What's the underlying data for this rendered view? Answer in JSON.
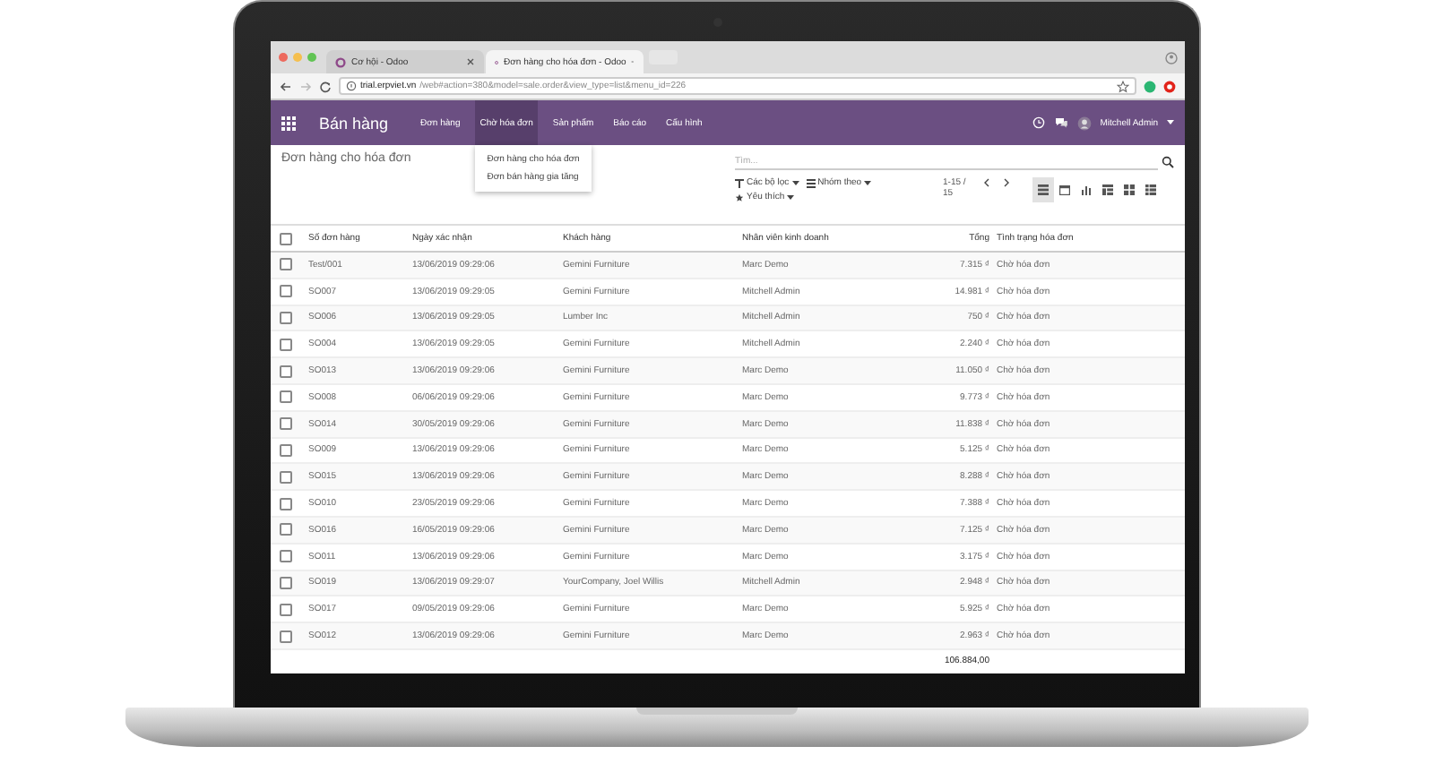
{
  "browser": {
    "tabs": [
      {
        "title": "Cơ hội - Odoo",
        "selected": false
      },
      {
        "title": "Đơn hàng cho hóa đơn - Odoo",
        "selected": true
      }
    ],
    "url_host": "trial.erpviet.vn",
    "url_path": "/web#action=380&model=sale.order&view_type=list&menu_id=226"
  },
  "navbar": {
    "app_name": "Bán hàng",
    "menu": [
      {
        "label": "Đơn hàng",
        "selected": false
      },
      {
        "label": "Chờ hóa đơn",
        "selected": true,
        "dropdown": [
          "Đơn hàng cho hóa đơn",
          "Đơn bán hàng gia tăng"
        ]
      },
      {
        "label": "Sản phẩm",
        "selected": false
      },
      {
        "label": "Báo cáo",
        "selected": false
      },
      {
        "label": "Cấu hình",
        "selected": false
      }
    ],
    "user": "Mitchell Admin"
  },
  "control_panel": {
    "breadcrumb": "Đơn hàng cho hóa đơn",
    "search": {
      "placeholder": "Tìm..."
    },
    "filters": "Các bộ lọc",
    "group_by": "Nhóm theo",
    "favorites": "Yêu thích",
    "pager": "1-15 / 15",
    "view_switcher": [
      {
        "kind": "list",
        "selected": true
      },
      {
        "kind": "calendar",
        "selected": false
      },
      {
        "kind": "graph",
        "selected": false
      },
      {
        "kind": "pivot",
        "selected": false
      },
      {
        "kind": "kanban",
        "selected": false
      },
      {
        "kind": "grid",
        "selected": false
      }
    ]
  },
  "table": {
    "select_all_checked": false,
    "columns": [
      "Số đơn hàng",
      "Ngày xác nhận",
      "Khách hàng",
      "Nhân viên kinh doanh",
      "Tổng",
      "Tình trạng hóa đơn"
    ],
    "rows": [
      {
        "checked": false,
        "cells": [
          "Test/001",
          "13/06/2019 09:29:06",
          "Gemini Furniture",
          "Marc Demo",
          "7.315 ₫",
          "Chờ hóa đơn"
        ]
      },
      {
        "checked": false,
        "cells": [
          "SO007",
          "13/06/2019 09:29:05",
          "Gemini Furniture",
          "Mitchell Admin",
          "14.981 ₫",
          "Chờ hóa đơn"
        ]
      },
      {
        "checked": false,
        "cells": [
          "SO006",
          "13/06/2019 09:29:05",
          "Lumber Inc",
          "Mitchell Admin",
          "750 ₫",
          "Chờ hóa đơn"
        ]
      },
      {
        "checked": false,
        "cells": [
          "SO004",
          "13/06/2019 09:29:05",
          "Gemini Furniture",
          "Mitchell Admin",
          "2.240 ₫",
          "Chờ hóa đơn"
        ]
      },
      {
        "checked": false,
        "cells": [
          "SO013",
          "13/06/2019 09:29:06",
          "Gemini Furniture",
          "Marc Demo",
          "11.050 ₫",
          "Chờ hóa đơn"
        ]
      },
      {
        "checked": false,
        "cells": [
          "SO008",
          "06/06/2019 09:29:06",
          "Gemini Furniture",
          "Marc Demo",
          "9.773 ₫",
          "Chờ hóa đơn"
        ]
      },
      {
        "checked": false,
        "cells": [
          "SO014",
          "30/05/2019 09:29:06",
          "Gemini Furniture",
          "Marc Demo",
          "11.838 ₫",
          "Chờ hóa đơn"
        ]
      },
      {
        "checked": false,
        "cells": [
          "SO009",
          "13/06/2019 09:29:06",
          "Gemini Furniture",
          "Marc Demo",
          "5.125 ₫",
          "Chờ hóa đơn"
        ]
      },
      {
        "checked": false,
        "cells": [
          "SO015",
          "13/06/2019 09:29:06",
          "Gemini Furniture",
          "Marc Demo",
          "8.288 ₫",
          "Chờ hóa đơn"
        ]
      },
      {
        "checked": false,
        "cells": [
          "SO010",
          "23/05/2019 09:29:06",
          "Gemini Furniture",
          "Marc Demo",
          "7.388 ₫",
          "Chờ hóa đơn"
        ]
      },
      {
        "checked": false,
        "cells": [
          "SO016",
          "16/05/2019 09:29:06",
          "Gemini Furniture",
          "Marc Demo",
          "7.125 ₫",
          "Chờ hóa đơn"
        ]
      },
      {
        "checked": false,
        "cells": [
          "SO011",
          "13/06/2019 09:29:06",
          "Gemini Furniture",
          "Marc Demo",
          "3.175 ₫",
          "Chờ hóa đơn"
        ]
      },
      {
        "checked": false,
        "cells": [
          "SO019",
          "13/06/2019 09:29:07",
          "YourCompany, Joel Willis",
          "Mitchell Admin",
          "2.948 ₫",
          "Chờ hóa đơn"
        ]
      },
      {
        "checked": false,
        "cells": [
          "SO017",
          "09/05/2019 09:29:06",
          "Gemini Furniture",
          "Marc Demo",
          "5.925 ₫",
          "Chờ hóa đơn"
        ]
      },
      {
        "checked": false,
        "cells": [
          "SO012",
          "13/06/2019 09:29:06",
          "Gemini Furniture",
          "Marc Demo",
          "2.963 ₫",
          "Chờ hóa đơn"
        ]
      }
    ],
    "total": "106.884,00"
  }
}
